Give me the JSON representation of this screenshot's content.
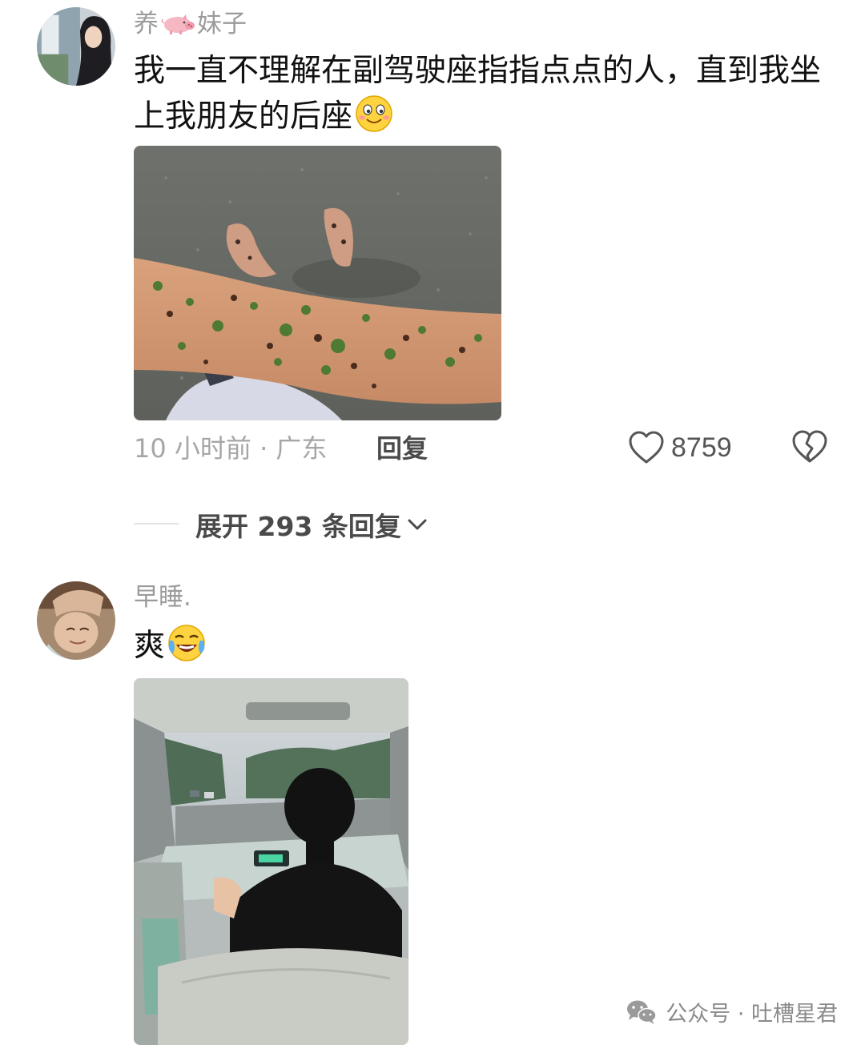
{
  "comments": [
    {
      "username_prefix": "养",
      "username_emoji": "pig-emoji",
      "username_suffix": "妹子",
      "text": "我一直不理解在副驾驶座指指点点的人，直到我坐上我朋友的后座",
      "text_emoji": "smile-emoji",
      "photo": "photo-muddy-leg-on-road",
      "time_location": "10 小时前 · 广东",
      "reply_label": "回复",
      "like_count": "8759",
      "expand_replies_label": "展开 293 条回复"
    },
    {
      "username": "早睡.",
      "text": "爽",
      "text_emoji": "laughing-tears-emoji",
      "photo": "photo-car-backseat-view"
    }
  ],
  "watermark": {
    "text": "公众号 · 吐槽星君",
    "icon": "wechat-icon"
  },
  "colors": {
    "username": "#9b9b9b",
    "meta": "#a6a6a6",
    "action": "#4a4a4a"
  }
}
